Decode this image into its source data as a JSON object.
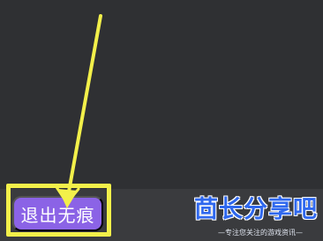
{
  "exit_button": {
    "label": "退出无痕"
  },
  "watermark": {
    "title": "茴长分享吧",
    "subtitle": "—专注您关注的游戏资讯—"
  },
  "colors": {
    "background": "#2f3033",
    "bottom_bar": "#3a3b3e",
    "highlight": "#f3f04a",
    "button": "#8b63e6",
    "watermark": "#2f68ee"
  },
  "icons": {
    "pointer": "arrow-icon"
  }
}
